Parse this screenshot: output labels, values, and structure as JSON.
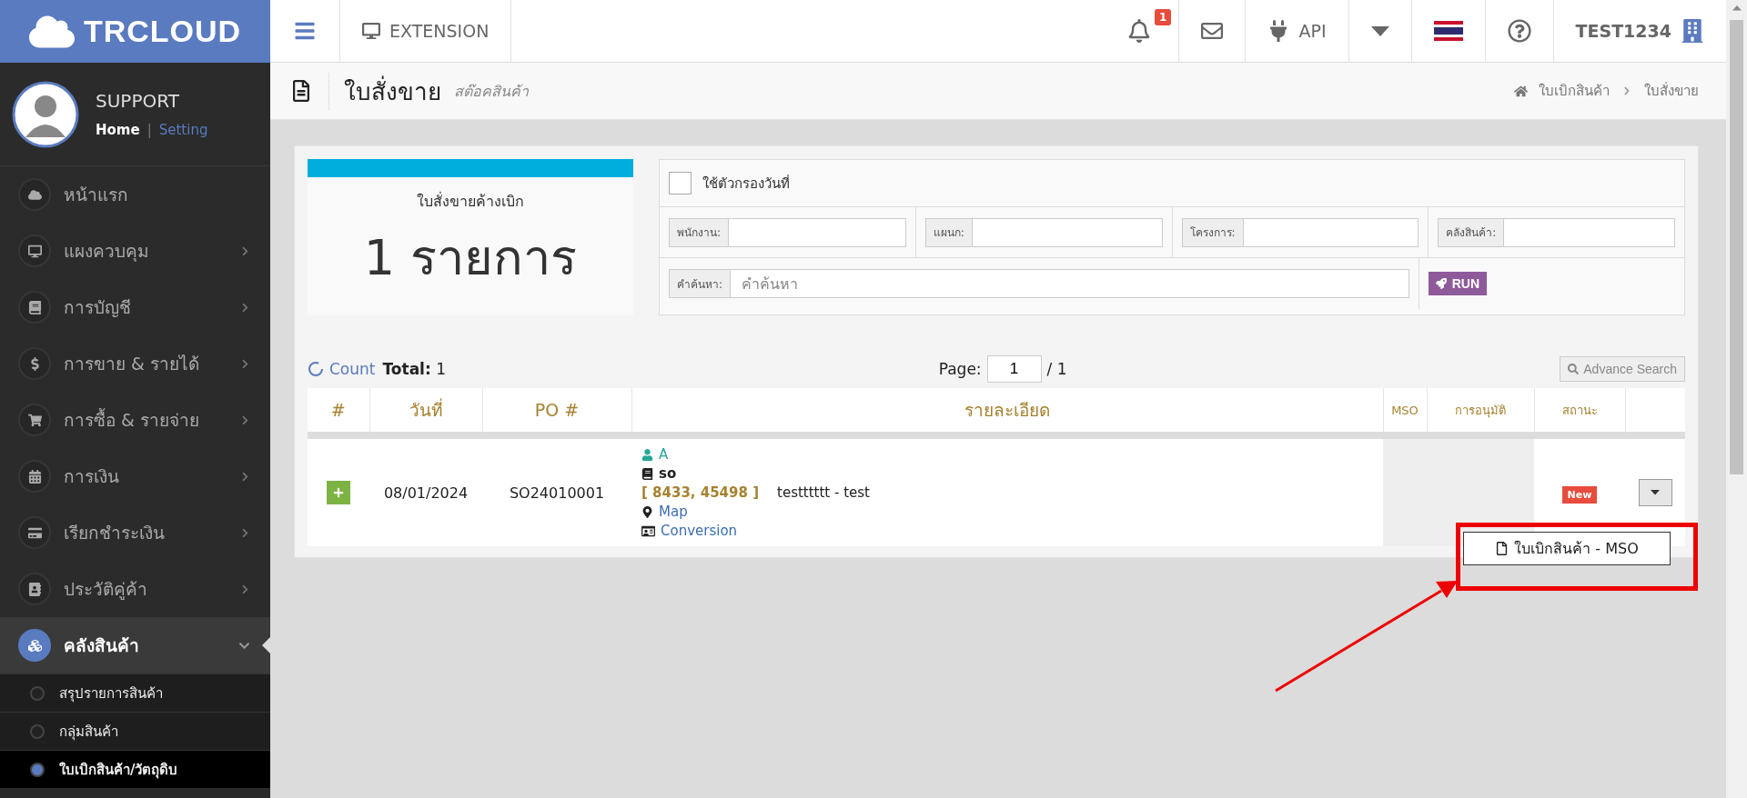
{
  "brand": "TRCLOUD",
  "topbar": {
    "extension": "EXTENSION",
    "notification_count": "1",
    "api": "API",
    "user": "TEST1234"
  },
  "profile": {
    "name": "SUPPORT",
    "separator": "|",
    "links": [
      {
        "label": "Home",
        "selected": true
      },
      {
        "label": "Setting",
        "selected": false
      }
    ]
  },
  "sidebar": {
    "items": [
      {
        "label": "หน้าแรก",
        "selected": false
      },
      {
        "label": "แผงควบคุม",
        "expanded": false,
        "selected": false
      },
      {
        "label": "การบัญชี",
        "expanded": false,
        "selected": false
      },
      {
        "label": "การขาย & รายได้",
        "expanded": false,
        "selected": false
      },
      {
        "label": "การซื้อ & รายจ่าย",
        "expanded": false,
        "selected": false
      },
      {
        "label": "การเงิน",
        "expanded": false,
        "selected": false
      },
      {
        "label": "เรียกชำระเงิน",
        "expanded": false,
        "selected": false
      },
      {
        "label": "ประวัติคู่ค้า",
        "expanded": false,
        "selected": false
      },
      {
        "label": "คลังสินค้า",
        "expanded": true,
        "selected": true,
        "children": [
          {
            "label": "สรุปรายการสินค้า",
            "selected": false
          },
          {
            "label": "กลุ่มสินค้า",
            "selected": false
          },
          {
            "label": "ใบเบิกสินค้า/วัตถุดิบ",
            "selected": true
          }
        ]
      }
    ]
  },
  "page_header": {
    "title": "ใบสั่งขาย",
    "subtitle": "สต๊อคสินค้า",
    "breadcrumb": [
      "ใบเบิกสินค้า",
      "ใบสั่งขาย"
    ]
  },
  "summary": {
    "label": "ใบสั่งขายค้างเบิก",
    "value": "1 รายการ"
  },
  "filters": {
    "date_filter": {
      "label": "ใช้ตัวกรองวันที่",
      "checked": false
    },
    "fields": [
      {
        "label": "พนักงาน:"
      },
      {
        "label": "แผนก:"
      },
      {
        "label": "โครงการ:"
      },
      {
        "label": "คลังสินค้า:"
      }
    ],
    "search": {
      "label": "คำค้นหา:",
      "placeholder": "คำค้นหา"
    },
    "run": "RUN"
  },
  "count": {
    "link": "Count",
    "total_label": "Total:",
    "total": "1"
  },
  "pager": {
    "label": "Page:",
    "value": "1",
    "of": "/ 1"
  },
  "advance_search": "Advance Search",
  "table": {
    "columns": [
      "#",
      "วันที่",
      "PO #",
      "รายละเอียด",
      "MSO",
      "การอนุมัติ",
      "สถานะ"
    ],
    "rows": [
      {
        "date": "08/01/2024",
        "po": "SO24010001",
        "contact": "A",
        "doc": "so",
        "code": "[ 8433, 45498 ]",
        "description": "testttttt - test",
        "map": "Map",
        "conversion": "Conversion",
        "status": "New",
        "menu_open": true
      }
    ]
  },
  "row_menu": {
    "items": [
      "ใบเบิกสินค้า - MSO"
    ]
  }
}
